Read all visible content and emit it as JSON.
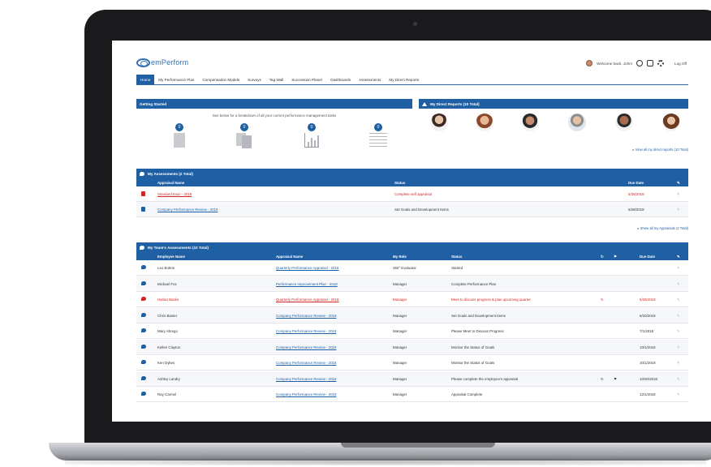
{
  "app": {
    "logo_text": "emPerform"
  },
  "user": {
    "welcome": "Welcome back, John!",
    "logoff": "Log Off"
  },
  "nav": [
    {
      "label": "Home",
      "active": true
    },
    {
      "label": "My Performance Plan"
    },
    {
      "label": "Compensation Models"
    },
    {
      "label": "Surveys"
    },
    {
      "label": "Tag Wall"
    },
    {
      "label": "Succession Planer"
    },
    {
      "label": "Dashboards"
    },
    {
      "label": "Assessments"
    },
    {
      "label": "My Direct Reports"
    }
  ],
  "getting_started": {
    "title": "Getting Started",
    "subtitle": "See below for a breakdown of all your current performance management tasks",
    "badges": [
      "0",
      "0",
      "0",
      "0"
    ]
  },
  "direct_reports": {
    "title": "My Direct Reports (10 Total)",
    "view_all": "View all my direct reports (10 Total)"
  },
  "my_assessments": {
    "title": "My Assessments (2 Total)",
    "columns": [
      "Appraisal Name",
      "Status",
      "Due Date"
    ],
    "rows": [
      {
        "name": "Standard Eval – 2018",
        "status": "Complete self appraisal",
        "due": "5/28/2018",
        "overdue": true
      },
      {
        "name": "Company Performance Review - 2018",
        "status": "Set Goals and Development Items",
        "due": "6/28/2018",
        "overdue": false
      }
    ],
    "show_all": "Show all my Appraisals (2 Total)"
  },
  "team_assessments": {
    "title": "My Team's Assessments (10 Total)",
    "columns": [
      "Employee Name",
      "Appraisal Name",
      "My Role",
      "Status",
      "Due Date"
    ],
    "rows": [
      {
        "employee": "Leo Botton",
        "appraisal": "Quarterly Performance Appraisal - 2018",
        "role": "360° Evaluator",
        "status": "Started",
        "due": "",
        "overdue": false
      },
      {
        "employee": "Michael Fox",
        "appraisal": "Performance Improvement Plan - 2018",
        "role": "Manager",
        "status": "Complete Performance Plan",
        "due": "",
        "overdue": false
      },
      {
        "employee": "Harlan Banks",
        "appraisal": "Quarterly Performance Appraisal - 2018",
        "role": "Manager",
        "status": "Meet to discuss progress & plan upcoming quarter",
        "due": "5/28/2018",
        "overdue": true
      },
      {
        "employee": "Chris Baxter",
        "appraisal": "Company Performance Review - 2018",
        "role": "Manager",
        "status": "Set Goals and Development Items",
        "due": "6/20/2018",
        "overdue": false
      },
      {
        "employee": "Mary Abrego",
        "appraisal": "Company Performance Review - 2018",
        "role": "Manager",
        "status": "Please Meet to Discuss Progress",
        "due": "7/1/2018",
        "overdue": false
      },
      {
        "employee": "Kellen Clayton",
        "appraisal": "Company Performance Review - 2018",
        "role": "Manager",
        "status": "Monitor the Status of Goals",
        "due": "10/1/2018",
        "overdue": false
      },
      {
        "employee": "Ken Dykes",
        "appraisal": "Company Performance Review - 2018",
        "role": "Manager",
        "status": "Monitor the Status of Goals",
        "due": "10/1/2018",
        "overdue": false
      },
      {
        "employee": "Ashley Landry",
        "appraisal": "Company Performance Review - 2018",
        "role": "Manager",
        "status": "Please complete the employee's appraisal",
        "due": "10/20/2018",
        "overdue": false
      },
      {
        "employee": "Ray Carmel",
        "appraisal": "Company Performance Review - 2018",
        "role": "Manager",
        "status": "Appraisal Complete",
        "due": "12/1/2018",
        "overdue": false
      }
    ]
  },
  "colors": {
    "primary": "#1f5fa3",
    "overdue": "#d32525"
  }
}
